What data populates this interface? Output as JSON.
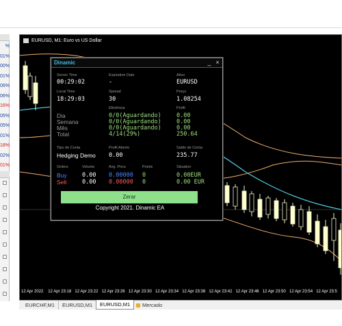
{
  "chart": {
    "title": "EURUSD, M1:  Euro vs US Dollar",
    "time_labels": [
      "12 Apr 2022",
      "12 Apr 23:18",
      "12 Apr 23:22",
      "12 Apr 23:26",
      "12 Apr 23:30",
      "12 Apr 23:34",
      "12 Apr 23:38",
      "12 Apr 23:42",
      "12 Apr 23:46",
      "12 Apr 23:50",
      "12 Apr 23:54",
      "12 Apr 23:5"
    ]
  },
  "left_panel": {
    "rows": [
      "%",
      "01%",
      "00%",
      "01%",
      "06%",
      "06%",
      "16%",
      "05%",
      "05%",
      "01%",
      "18%",
      "02%",
      "01%"
    ]
  },
  "tabs": [
    "EURCHF,M1",
    "EURUSD,M1",
    "EURUSD,M1",
    "Mercado"
  ],
  "ea": {
    "title": "Dinamic",
    "server_time_label": "Server Time",
    "server_time": "00:29:02",
    "expiration_label": "Expiration Date",
    "expiration": "-",
    "ativo_label": "Ativo",
    "ativo": "EURUSD",
    "local_time_label": "Local Time",
    "local_time": "18:29:03",
    "spread_label": "Spread",
    "spread": "30",
    "preco_label": "Preço",
    "preco": "1.08254",
    "eficiencia_label": "Eficiência",
    "profit_label": "Profit",
    "rows": [
      {
        "label": "Dia",
        "efficiency": "0/0(Aguardando)",
        "profit": "0.00"
      },
      {
        "label": "Semana",
        "efficiency": "0/0(Aguardando)",
        "profit": "0.00"
      },
      {
        "label": "Mês",
        "efficiency": "0/0(Aguardando)",
        "profit": "0.00"
      },
      {
        "label": "Total",
        "efficiency": "4/14(29%)",
        "profit": "250.64"
      }
    ],
    "tipo_conta_label": "Tipo de Conta",
    "tipo_conta": "Hedging Demo",
    "profit_aberto_label": "Profit Aberto",
    "profit_aberto": "0.00",
    "saldo_label": "Saldo de Conta",
    "saldo": "235.77",
    "orders_header": {
      "orders": "Orders",
      "volume": "Volume",
      "avg_price": "Avg. Price",
      "points": "Points",
      "situation": "Situation"
    },
    "buy": {
      "label": "Buy",
      "volume": "0.00",
      "avg_price": "0.00000",
      "points": "0",
      "situation": "0.00EUR"
    },
    "sell": {
      "label": "Sell",
      "volume": "0.00",
      "avg_price": "0.00000",
      "points": "0",
      "situation": "0.00 EUR"
    },
    "zerar_label": "Zerar",
    "copyright": "Copyright 2021. Dinamic EA",
    "minimize_glyph": "_",
    "close_glyph": "×"
  },
  "colors": {
    "chart_bg": "#000000",
    "bull_candle": "#ffffcc",
    "bear_candle": "#000000",
    "band_outer": "#f2b071",
    "band_mid": "#4fc3d9",
    "panel_title": "#3ec1e8",
    "green_values": "#9de07f",
    "zerar_button": "#8ee08a"
  }
}
